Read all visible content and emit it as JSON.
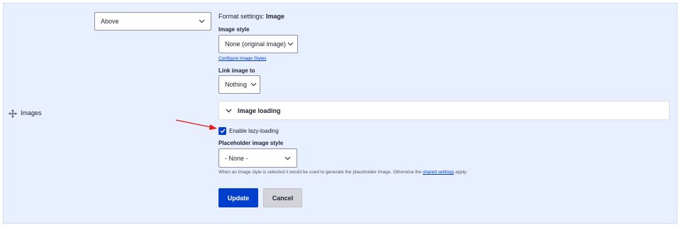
{
  "field": {
    "label": "Images",
    "label_position": "Above"
  },
  "format_settings": {
    "title_prefix": "Format settings:",
    "title_name": "Image",
    "image_style_label": "Image style",
    "image_style_value": "None (original image)",
    "configure_link": "Configure Image Styles",
    "link_image_label": "Link image to",
    "link_image_value": "Nothing",
    "image_loading_summary": "Image loading",
    "lazy_loading_label": "Enable lazy-loading",
    "lazy_loading_checked": true,
    "placeholder_label": "Placeholder image style",
    "placeholder_value": "- None -",
    "help_text_before": "When an image style is selected it would be used to generate the placeholder image. Otherwise the",
    "help_link": "shared settings",
    "help_text_after": "apply."
  },
  "actions": {
    "update_label": "Update",
    "cancel_label": "Cancel"
  },
  "icons": {
    "drag": "move-handle-icon",
    "chevron": "chevron-down-icon",
    "check": "checkmark-icon",
    "annotation": "red-arrow"
  },
  "colors": {
    "accent": "#003ecc",
    "panel_bg": "#e8effe",
    "annotation": "#e0201c"
  }
}
